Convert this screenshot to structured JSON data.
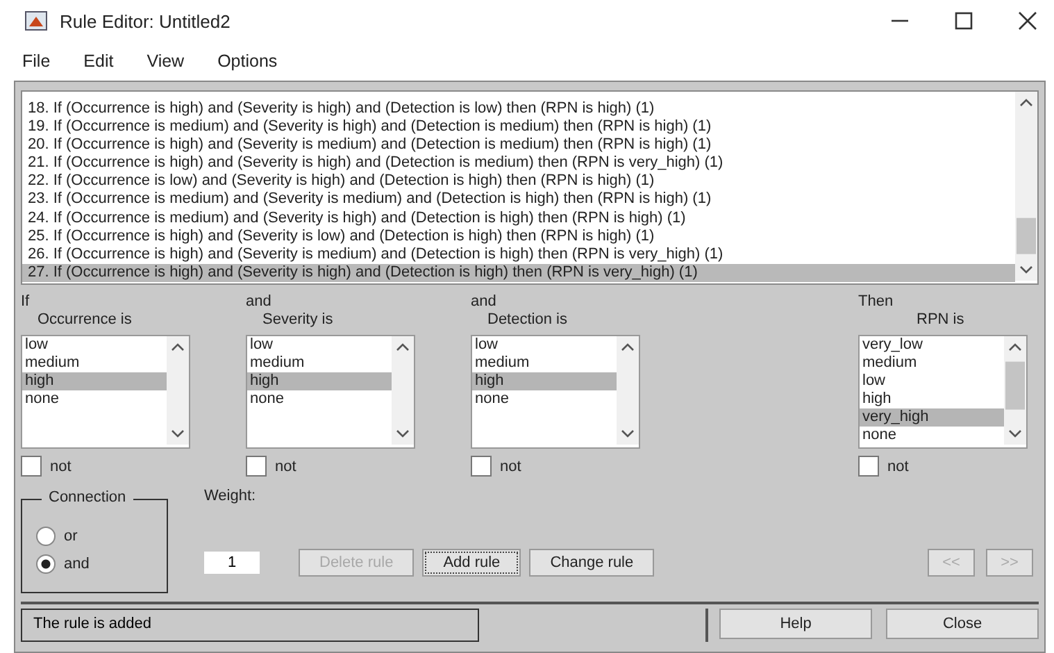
{
  "window": {
    "title": "Rule Editor: Untitled2"
  },
  "menu": [
    "File",
    "Edit",
    "View",
    "Options"
  ],
  "rules": [
    {
      "text": "18. If (Occurrence is high) and (Severity is high) and (Detection is low) then (RPN is high) (1)",
      "selected": false
    },
    {
      "text": "19. If (Occurrence is medium) and (Severity is high) and (Detection is medium) then (RPN is high) (1)",
      "selected": false
    },
    {
      "text": "20. If (Occurrence is high) and (Severity is medium) and (Detection is medium) then (RPN is high) (1)",
      "selected": false
    },
    {
      "text": "21. If (Occurrence is high) and (Severity is high) and (Detection is medium) then (RPN is very_high) (1)",
      "selected": false
    },
    {
      "text": "22. If (Occurrence is low) and (Severity is high) and (Detection is high) then (RPN is high) (1)",
      "selected": false
    },
    {
      "text": "23. If (Occurrence is medium) and (Severity is medium) and (Detection is high) then (RPN is high) (1)",
      "selected": false
    },
    {
      "text": "24. If (Occurrence is medium) and (Severity is high) and (Detection is high) then (RPN is high) (1)",
      "selected": false
    },
    {
      "text": "25. If (Occurrence is high) and (Severity is low) and (Detection is high) then (RPN is high) (1)",
      "selected": false
    },
    {
      "text": "26. If (Occurrence is high) and (Severity is medium) and (Detection is high) then (RPN is very_high) (1)",
      "selected": false
    },
    {
      "text": "27. If (Occurrence is high) and (Severity is high) and (Detection is high) then (RPN is very_high) (1)",
      "selected": true
    }
  ],
  "inputs": [
    {
      "prefix": "If",
      "label": "Occurrence is",
      "options": [
        {
          "label": "low",
          "selected": false
        },
        {
          "label": "medium",
          "selected": false
        },
        {
          "label": "high",
          "selected": true
        },
        {
          "label": "none",
          "selected": false
        }
      ],
      "not": {
        "label": "not",
        "checked": false
      }
    },
    {
      "prefix": "and",
      "label": "Severity is",
      "options": [
        {
          "label": "low",
          "selected": false
        },
        {
          "label": "medium",
          "selected": false
        },
        {
          "label": "high",
          "selected": true
        },
        {
          "label": "none",
          "selected": false
        }
      ],
      "not": {
        "label": "not",
        "checked": false
      }
    },
    {
      "prefix": "and",
      "label": "Detection is",
      "options": [
        {
          "label": "low",
          "selected": false
        },
        {
          "label": "medium",
          "selected": false
        },
        {
          "label": "high",
          "selected": true
        },
        {
          "label": "none",
          "selected": false
        }
      ],
      "not": {
        "label": "not",
        "checked": false
      }
    }
  ],
  "output": {
    "prefix": "Then",
    "label": "RPN is",
    "options": [
      {
        "label": "very_low",
        "selected": false
      },
      {
        "label": "medium",
        "selected": false
      },
      {
        "label": "low",
        "selected": false
      },
      {
        "label": "high",
        "selected": false
      },
      {
        "label": "very_high",
        "selected": true
      },
      {
        "label": "none",
        "selected": false
      }
    ],
    "not": {
      "label": "not",
      "checked": false
    }
  },
  "connection": {
    "title": "Connection",
    "options": [
      {
        "label": "or",
        "selected": false
      },
      {
        "label": "and",
        "selected": true
      }
    ]
  },
  "weight": {
    "label": "Weight:",
    "value": "1"
  },
  "buttons": [
    {
      "label": "Delete rule",
      "disabled": true,
      "focused": false
    },
    {
      "label": "Add rule",
      "disabled": false,
      "focused": true
    },
    {
      "label": "Change rule",
      "disabled": false,
      "focused": false
    }
  ],
  "nav_buttons": [
    {
      "label": "<<",
      "disabled": true
    },
    {
      "label": ">>",
      "disabled": true
    }
  ],
  "status": "The rule is added",
  "footer_buttons": [
    "Help",
    "Close"
  ]
}
